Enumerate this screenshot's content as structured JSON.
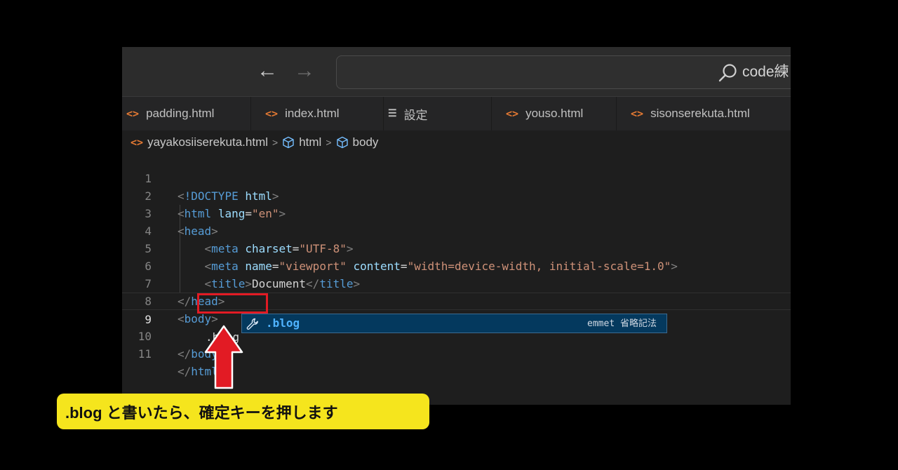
{
  "titlebar": {
    "back_icon": "arrow-left-icon",
    "forward_icon": "arrow-right-icon",
    "search_text": "code練"
  },
  "tabs": [
    {
      "label": "padding.html",
      "icon": "html-file-icon"
    },
    {
      "label": "index.html",
      "icon": "html-file-icon"
    },
    {
      "label": "設定",
      "icon": "settings-icon"
    },
    {
      "label": "youso.html",
      "icon": "html-file-icon"
    },
    {
      "label": "sisonserekuta.html",
      "icon": "html-file-icon"
    }
  ],
  "breadcrumb": {
    "file": "yayakosiiserekuta.html",
    "items": [
      "html",
      "body"
    ]
  },
  "editor": {
    "line_numbers": [
      "1",
      "2",
      "3",
      "4",
      "5",
      "6",
      "7",
      "8",
      "9",
      "10",
      "11"
    ],
    "current_line": "9",
    "typed_text": ".blog"
  },
  "suggestion": {
    "label": ".blog",
    "detail": "emmet 省略記法",
    "icon": "wrench-icon"
  },
  "callout": {
    "text": ".blog と書いたら、確定キーを押します"
  },
  "colors": {
    "tag": "#569cd6",
    "attribute": "#9cdcfe",
    "string": "#ce9178",
    "punctuation": "#808080",
    "highlight_box": "#e21b24",
    "callout_bg": "#f5e51d",
    "suggest_bg": "#04395e"
  }
}
